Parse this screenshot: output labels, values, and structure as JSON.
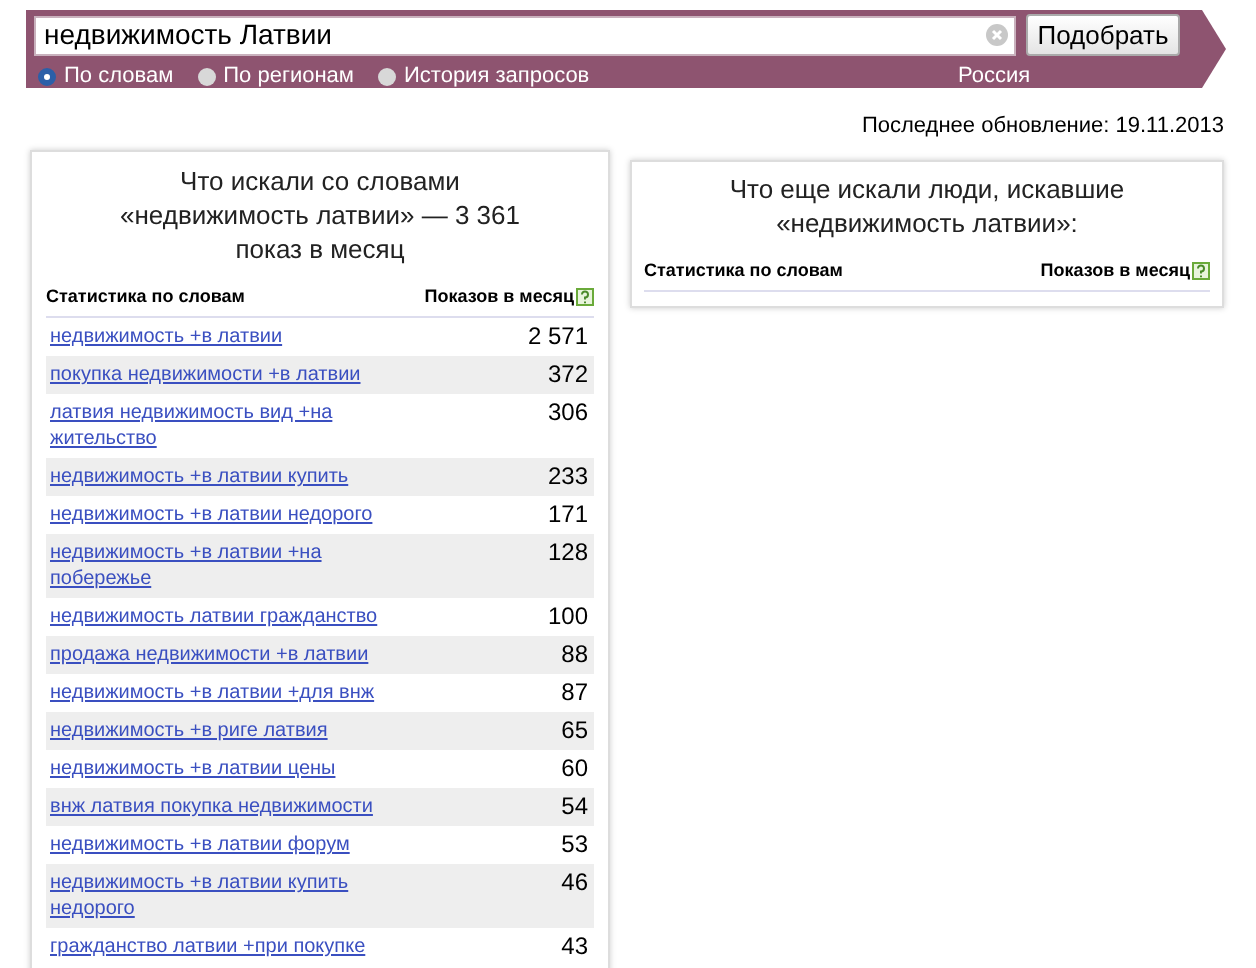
{
  "search": {
    "value": "недвижимость Латвии",
    "button": "Подобрать",
    "modes": [
      {
        "label": "По словам",
        "selected": true
      },
      {
        "label": "По регионам",
        "selected": false
      },
      {
        "label": "История запросов",
        "selected": false
      }
    ],
    "region": "Россия"
  },
  "last_update": "Последнее обновление: 19.11.2013",
  "left_panel": {
    "title": "Что искали со словами «недвижимость латвии» — 3 361 показ в месяц",
    "columns": [
      "Статистика по словам",
      "Показов в месяц"
    ],
    "rows": [
      {
        "phrase": "недвижимость +в латвии",
        "count": "2 571"
      },
      {
        "phrase": "покупка недвижимости +в латвии",
        "count": "372"
      },
      {
        "phrase": "латвия недвижимость вид +на жительство",
        "count": "306"
      },
      {
        "phrase": "недвижимость +в латвии купить",
        "count": "233"
      },
      {
        "phrase": "недвижимость +в латвии недорого",
        "count": "171"
      },
      {
        "phrase": "недвижимость +в латвии +на побережье",
        "count": "128"
      },
      {
        "phrase": "недвижимость латвии гражданство",
        "count": "100"
      },
      {
        "phrase": "продажа недвижимости +в латвии",
        "count": "88"
      },
      {
        "phrase": "недвижимость +в латвии +для внж",
        "count": "87"
      },
      {
        "phrase": "недвижимость +в риге латвия",
        "count": "65"
      },
      {
        "phrase": "недвижимость +в латвии цены",
        "count": "60"
      },
      {
        "phrase": "внж латвия покупка недвижимости",
        "count": "54"
      },
      {
        "phrase": "недвижимость +в латвии форум",
        "count": "53"
      },
      {
        "phrase": "недвижимость +в латвии купить недорого",
        "count": "46"
      },
      {
        "phrase": "гражданство латвии +при покупке",
        "count": "43"
      }
    ]
  },
  "right_panel": {
    "title": "Что еще искали люди, искавшие «недвижимость латвии»:",
    "columns": [
      "Статистика по словам",
      "Показов в месяц"
    ]
  }
}
